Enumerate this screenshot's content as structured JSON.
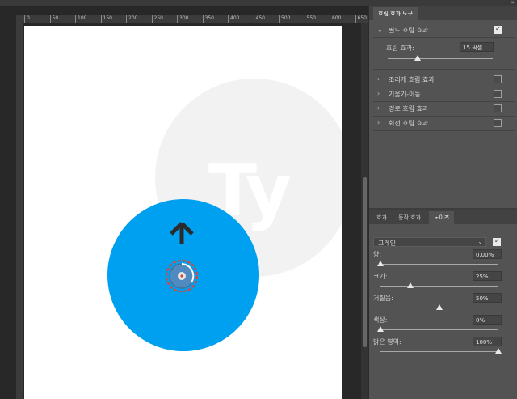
{
  "ruler": {
    "ticks": [
      "0",
      "50",
      "100",
      "150",
      "200",
      "250",
      "300",
      "350",
      "400",
      "450",
      "500",
      "550",
      "600",
      "650"
    ]
  },
  "canvas": {
    "watermark_text": "Ty"
  },
  "top_panel": {
    "tab_title": "흐림 효과 도구",
    "field_blur": {
      "label": "필드 흐림 효과",
      "checked": true
    },
    "blur_amount": {
      "label": "흐림 효과:",
      "value": "15 픽셀",
      "slider_fraction": 0.25
    },
    "items": [
      {
        "label": "조리개 흐림 효과",
        "checked": false
      },
      {
        "label": "기울기-이동",
        "checked": false
      },
      {
        "label": "경로 흐림 효과",
        "checked": false
      },
      {
        "label": "회전 흐림 효과",
        "checked": false
      }
    ]
  },
  "bottom_panel": {
    "tabs": [
      {
        "label": "효과"
      },
      {
        "label": "동작 효과"
      },
      {
        "label": "노이즈"
      }
    ],
    "active_tab": "노이즈",
    "noise_type": "그레인",
    "noise_enabled": true,
    "params": [
      {
        "label": "양:",
        "value": "0.00%",
        "fraction": 0.0
      },
      {
        "label": "크기:",
        "value": "25%",
        "fraction": 0.25
      },
      {
        "label": "거칠음:",
        "value": "50%",
        "fraction": 0.5
      },
      {
        "label": "색상:",
        "value": "0%",
        "fraction": 0.0
      },
      {
        "label": "밝은 영역:",
        "value": "100%",
        "fraction": 1.0
      }
    ]
  },
  "colors": {
    "blur_circle": "#00a0f0",
    "arrow": "#2b2b2b",
    "pin_ring": "#d9443c"
  },
  "icons": [
    "chevron-down-icon",
    "chevron-right-icon",
    "up-arrow-icon",
    "blur-pin-icon",
    "checkbox-icon"
  ]
}
